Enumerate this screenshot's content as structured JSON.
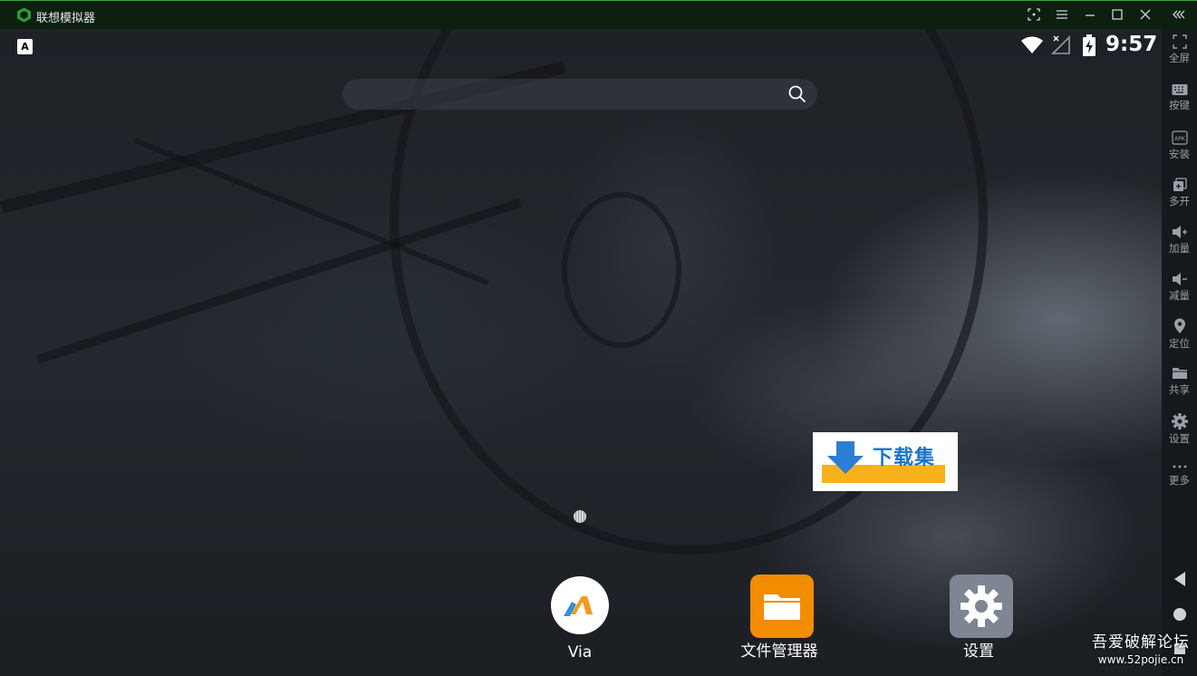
{
  "window": {
    "title": "联想模拟器",
    "accent_color": "#39a33b"
  },
  "status_bar": {
    "left_icon": "a-badge-icon",
    "left_icon_text": "A",
    "time": "9:57"
  },
  "search": {
    "placeholder": ""
  },
  "apps": [
    {
      "label": "Via",
      "icon": "via-browser-icon"
    },
    {
      "label": "文件管理器",
      "icon": "folder-icon",
      "color": "#f28c00"
    },
    {
      "label": "设置",
      "icon": "settings-gear-icon",
      "color": "#7e8593"
    }
  ],
  "toolbar": {
    "items": [
      {
        "label": "全屏",
        "icon": "fullscreen-icon"
      },
      {
        "label": "按键",
        "icon": "keyboard-icon"
      },
      {
        "label": "安装",
        "icon": "apk-icon"
      },
      {
        "label": "多开",
        "icon": "multi-instance-icon"
      },
      {
        "label": "加量",
        "icon": "volume-up-icon"
      },
      {
        "label": "减量",
        "icon": "volume-down-icon"
      },
      {
        "label": "定位",
        "icon": "location-pin-icon"
      },
      {
        "label": "共享",
        "icon": "folder-share-icon"
      },
      {
        "label": "设置",
        "icon": "gear-icon"
      },
      {
        "label": "更多",
        "icon": "more-dots-icon"
      }
    ]
  },
  "watermark": {
    "logo_text": "下载集"
  },
  "forum": {
    "name": "吾爱破解论坛",
    "url": "www.52pojie.cn"
  }
}
